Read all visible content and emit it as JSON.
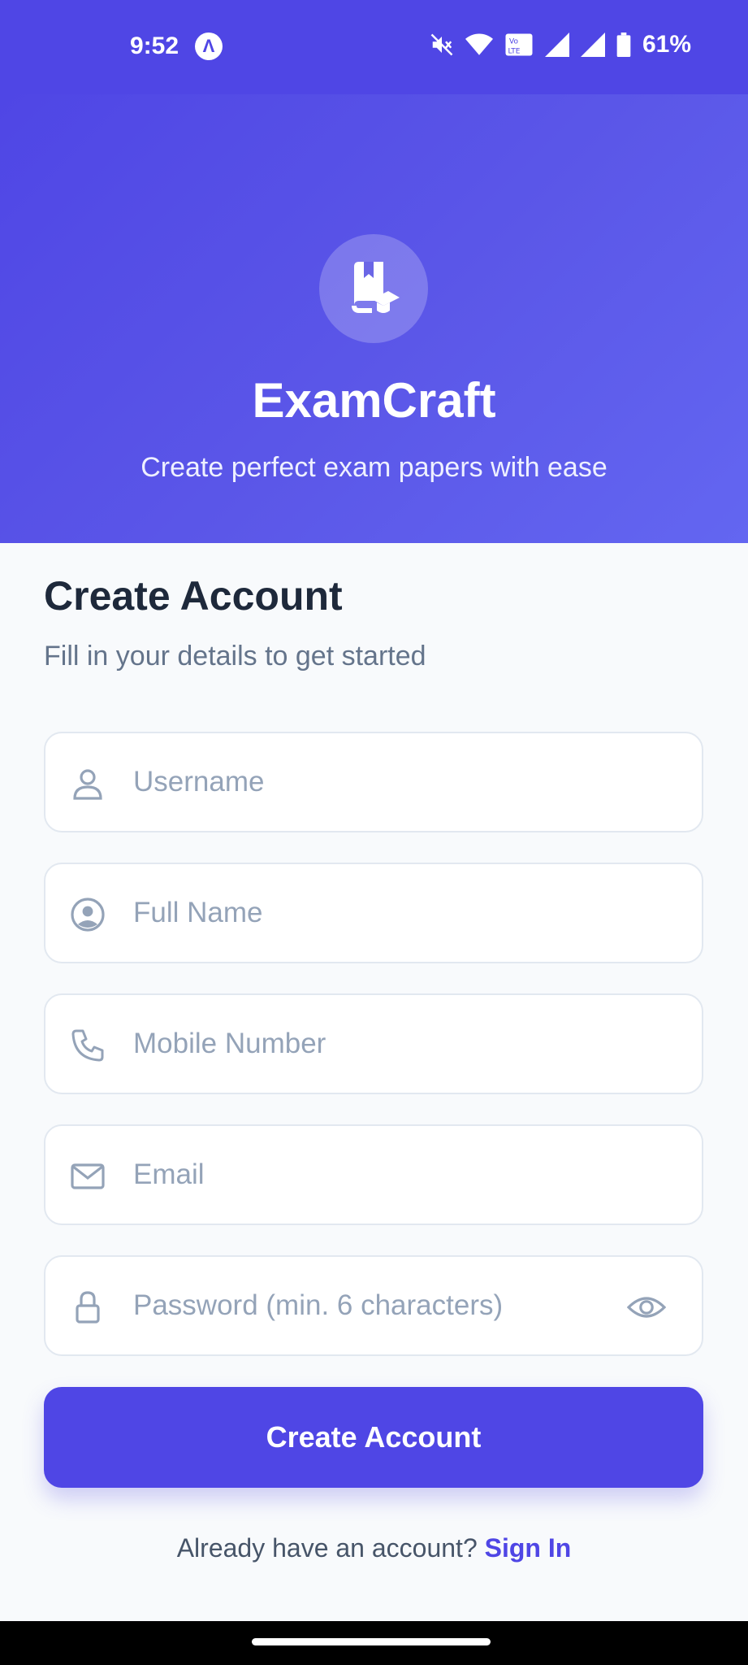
{
  "status_bar": {
    "time": "9:52",
    "app_icon_glyph": "Λ",
    "battery": "61%",
    "icons": [
      "mute-icon",
      "wifi-icon",
      "volte-icon",
      "signal-icon",
      "signal-roaming-icon",
      "battery-icon"
    ]
  },
  "hero": {
    "app_name": "ExamCraft",
    "tagline": "Create perfect exam papers with ease",
    "logo_icon": "book-graduation-cap-icon"
  },
  "form": {
    "title": "Create Account",
    "subtitle": "Fill in your details to get started",
    "fields": {
      "username": {
        "placeholder": "Username",
        "value": "",
        "icon": "user-icon"
      },
      "full_name": {
        "placeholder": "Full Name",
        "value": "",
        "icon": "user-circle-icon"
      },
      "mobile": {
        "placeholder": "Mobile Number",
        "value": "",
        "icon": "phone-icon"
      },
      "email": {
        "placeholder": "Email",
        "value": "",
        "icon": "mail-icon"
      },
      "password": {
        "placeholder": "Password (min. 6 characters)",
        "value": "",
        "icon": "lock-icon",
        "toggle_icon": "eye-icon"
      }
    },
    "submit_label": "Create Account",
    "signin_prompt": "Already have an account?",
    "signin_link": "Sign In"
  },
  "colors": {
    "primary": "#4f46e5",
    "background": "#f8fafc",
    "title_text": "#1e293b",
    "muted_text": "#64748b",
    "placeholder": "#94a3b8",
    "border": "#e2e8f0"
  }
}
